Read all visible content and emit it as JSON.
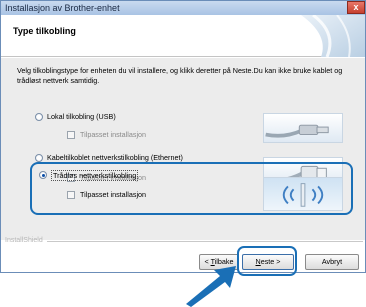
{
  "window": {
    "title": "Installasjon av Brother-enhet",
    "close_glyph": "x"
  },
  "header": {
    "title": "Type tilkobling"
  },
  "description": "Velg tilkoblingstype for enheten du vil installere, og klikk deretter på Neste.Du kan ikke bruke kablet og trådløst nettverk samtidig.",
  "options": [
    {
      "label": "Lokal tilkobling (USB)",
      "sub_label": "Tilpasset installasjon",
      "selected": false,
      "icon": "usb-cable"
    },
    {
      "label": "Kabeltilkoblet nettverkstilkobling (Ethernet)",
      "sub_label": "Tilpasset installasjon",
      "selected": false,
      "icon": "ethernet-cable"
    },
    {
      "label": "Trådløs nettverkstilkobling",
      "sub_label": "Tilpasset installasjon",
      "selected": true,
      "icon": "wireless-access-point"
    }
  ],
  "footer": {
    "brand": "InstallShield",
    "back_button": {
      "pre": "< ",
      "accel": "T",
      "post": "ilbake"
    },
    "next_button": {
      "accel": "N",
      "post": "este >"
    },
    "cancel_button": "Avbryt"
  },
  "colors": {
    "highlight": "#1a6fb6",
    "titlebar": "#a9c3e4",
    "arrow": "#1a6fb6"
  }
}
